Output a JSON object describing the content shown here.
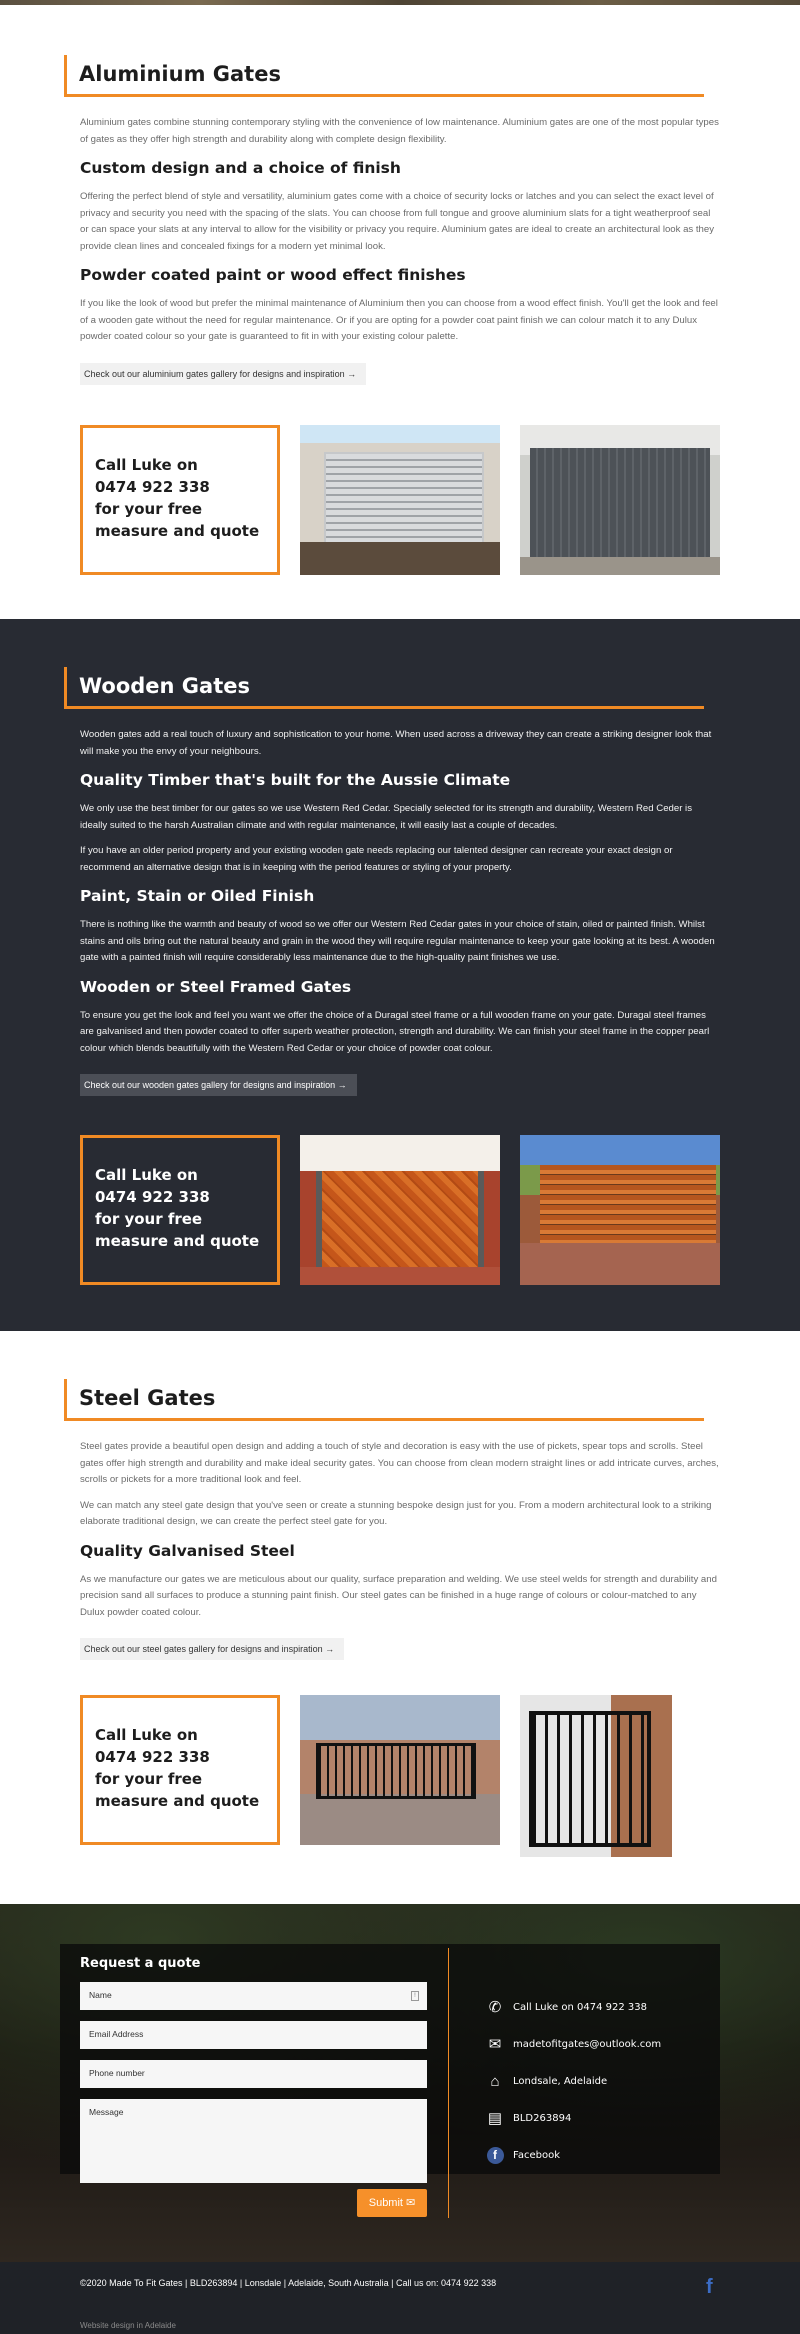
{
  "accent_color": "#f08a24",
  "call_card": {
    "line1": "Call Luke on",
    "line2": "0474 922 338",
    "line3": "for your free",
    "line4": "measure and quote"
  },
  "aluminium": {
    "title": "Aluminium Gates",
    "intro": "Aluminium gates combine stunning contemporary styling with the convenience of low maintenance.  Aluminium gates are one of the most popular types of gates as they offer high strength and durability along with complete design flexibility.",
    "h1": "Custom design and a choice of finish",
    "p1": "Offering the perfect blend of style and versatility, aluminium gates come with a choice of security locks or latches and you can select the exact level of privacy and security you need with the spacing of the slats.  You can choose from full tongue and groove aluminium slats for a tight weatherproof seal or can space your slats at any interval to allow for the visibility or privacy you require.  Aluminium gates are ideal to create an architectural look as they provide clean lines and concealed fixings for a modern yet minimal look.",
    "h2": "Powder coated paint or wood effect finishes",
    "p2": "If you like the look of wood but prefer the minimal maintenance of Aluminium then you can choose from a wood effect finish.  You'll get the look and feel of a wooden gate without the need for regular maintenance. Or if you are opting for a powder coat paint finish we can colour match it to any Dulux powder coated colour so your gate is guaranteed to fit in with your existing colour palette.",
    "gallery_link": "Check out our aluminium gates gallery for designs and inspiration →"
  },
  "wooden": {
    "title": "Wooden Gates",
    "intro": "Wooden gates add a real touch of luxury and sophistication to your home.  When used across a driveway they can create a striking designer look that will make you the envy of your neighbours.",
    "h1": "Quality Timber that's built for the Aussie Climate",
    "p1": "We only use the best timber for our gates so we use Western Red Cedar.  Specially selected for its strength and durability, Western Red Ceder is ideally suited to the harsh Australian climate and with regular maintenance, it will easily last a couple of decades.",
    "p1b": "If you have an older period property and your existing wooden gate needs replacing our talented designer can recreate your exact design or recommend an alternative design that is in keeping with the period features or styling of your property.",
    "h2": "Paint, Stain or Oiled Finish",
    "p2": "There is nothing like the warmth and beauty of wood so we offer our Western Red Cedar gates in your choice of stain, oiled or painted finish.  Whilst stains and oils bring out the natural beauty and grain in the wood they will require regular maintenance to keep your gate looking at its best.  A wooden gate with a painted finish will require considerably less maintenance due to the high-quality paint finishes we use.",
    "h3": "Wooden or Steel Framed Gates",
    "p3": "To ensure you get the look and feel you want we offer the choice of a Duragal steel frame or a full wooden frame on your gate. Duragal steel frames are galvanised and then powder coated to offer superb weather protection, strength and durability.  We can finish your steel frame in the copper pearl colour which blends beautifully with the Western Red Cedar or your choice of powder coat colour.",
    "gallery_link": "Check out our wooden gates gallery for designs and inspiration →"
  },
  "steel": {
    "title": "Steel Gates",
    "intro": "Steel gates provide a beautiful open design and adding a touch of style and decoration is easy with the use of pickets, spear tops and scrolls.  Steel gates offer high strength and durability and make ideal security gates.  You can choose from clean modern straight lines or add intricate curves, arches, scrolls or pickets for a more traditional look and feel.",
    "intro2": "We can match any steel gate design that you've seen or create a stunning bespoke design just for you.  From a modern architectural look to a striking elaborate traditional design, we can create the perfect steel gate for you.",
    "h1": "Quality Galvanised Steel",
    "p1": "As we manufacture our gates we are meticulous about our quality, surface preparation and welding.  We use steel welds for strength and durability and precision sand all surfaces to produce a stunning paint finish.  Our steel gates can be finished in a huge range of colours or colour-matched to any Dulux powder coated colour.",
    "gallery_link": "Check out our steel gates gallery for designs and inspiration →"
  },
  "quote_form": {
    "title": "Request a quote",
    "name_placeholder": "Name",
    "email_placeholder": "Email Address",
    "phone_placeholder": "Phone number",
    "message_placeholder": "Message",
    "submit_label": "Submit ✉"
  },
  "contact": {
    "phone": "Call Luke on 0474 922 338",
    "email": "madetofitgates@outlook.com",
    "location": "Londsale, Adelaide",
    "licence": "BLD263894",
    "facebook": "Facebook"
  },
  "footer": {
    "copyright": "©2020 Made To Fit Gates | BLD263894 | Lonsdale | Adelaide, South Australia | Call us on: 0474 922 338",
    "credit": "Website design in Adelaide",
    "fb_glyph": "f"
  }
}
